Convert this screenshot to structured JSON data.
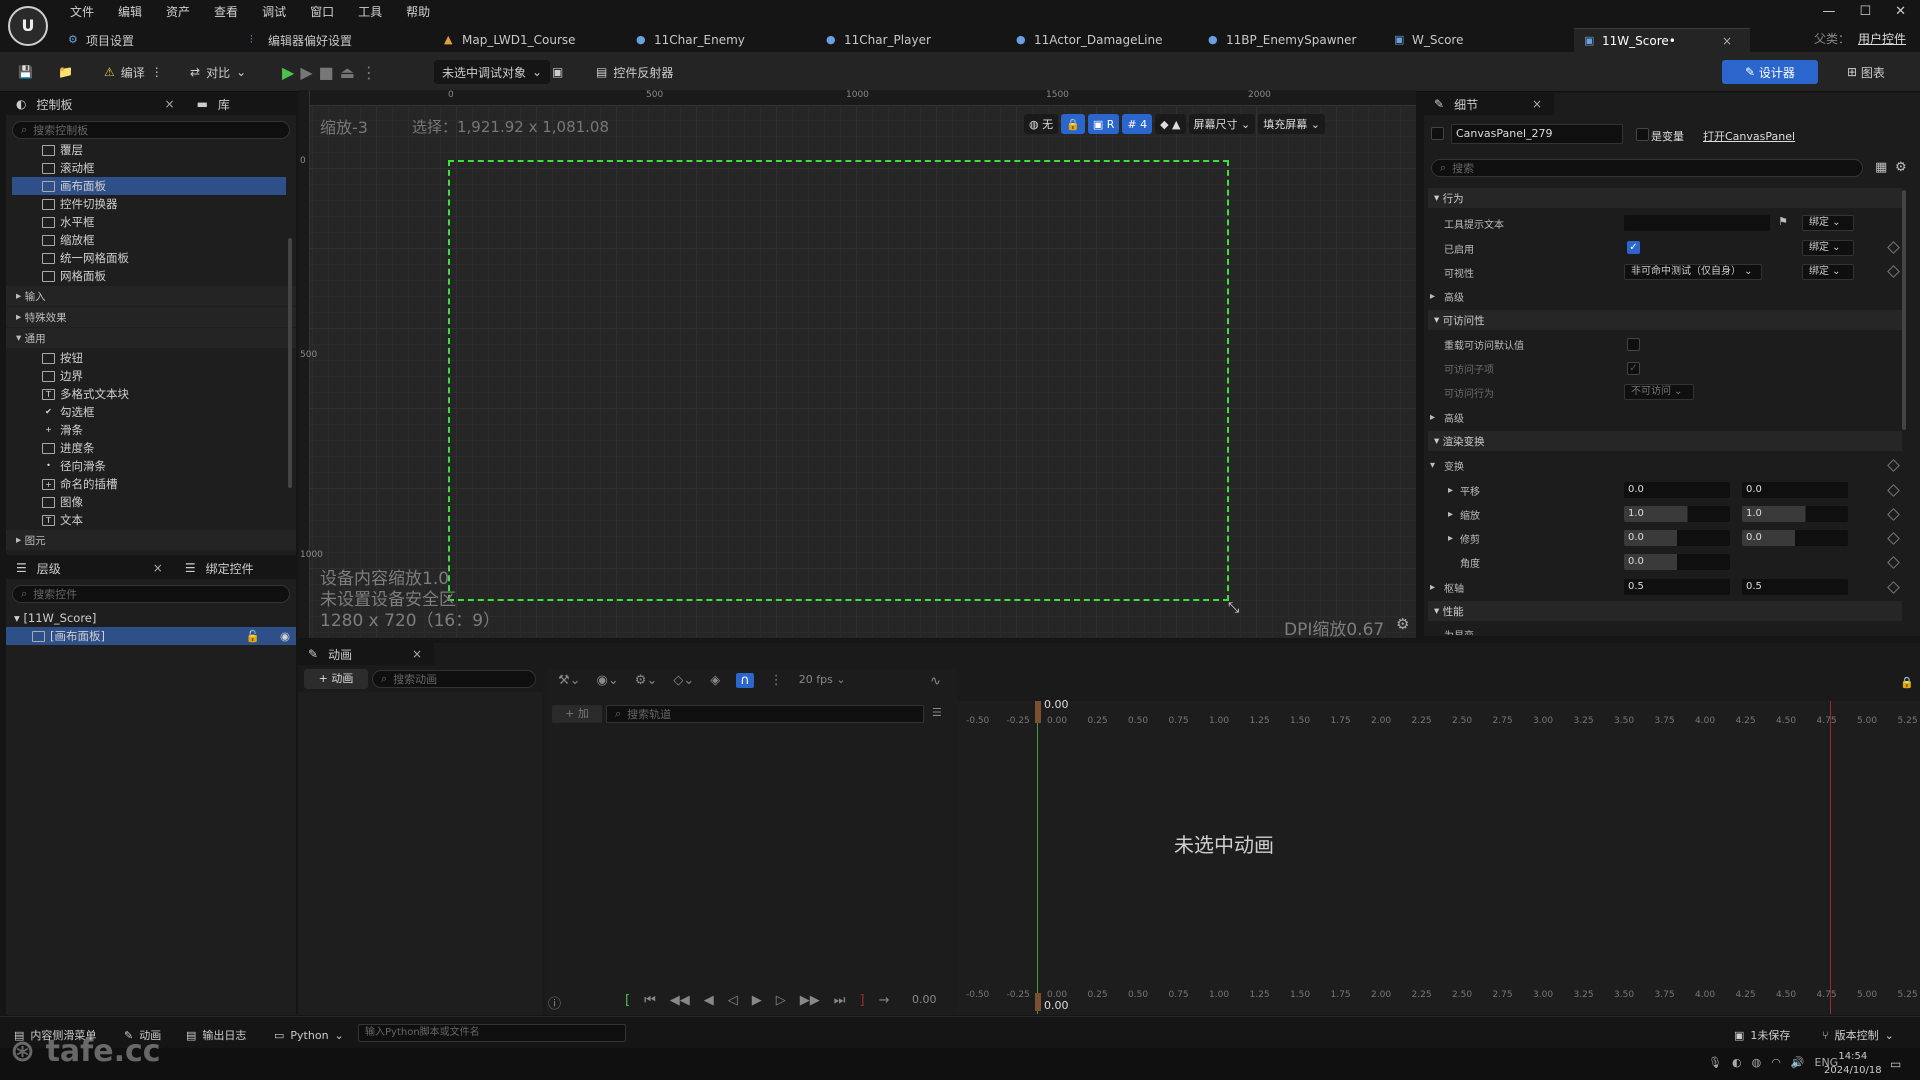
{
  "app": {
    "logo": "U"
  },
  "menu": [
    "文件",
    "编辑",
    "资产",
    "查看",
    "调试",
    "窗口",
    "工具",
    "帮助"
  ],
  "tabs": [
    {
      "label": "项目设置",
      "icon": "gear-icon"
    },
    {
      "label": "编辑器偏好设置",
      "icon": "sliders-icon"
    },
    {
      "label": "Map_LWD1_Course",
      "icon": "level-icon"
    },
    {
      "label": "11Char_Enemy",
      "icon": "character-icon"
    },
    {
      "label": "11Char_Player",
      "icon": "character-icon"
    },
    {
      "label": "11Actor_DamageLine",
      "icon": "actor-icon"
    },
    {
      "label": "11BP_EnemySpawner",
      "icon": "actor-icon"
    },
    {
      "label": "W_Score",
      "icon": "widget-icon"
    },
    {
      "label": "11W_Score•",
      "icon": "widget-icon",
      "active": true
    }
  ],
  "parent": {
    "label": "父类：",
    "value": "用户控件"
  },
  "toolbar": {
    "compile": "编译",
    "diff": "对比",
    "debug_target": "未选中调试对象",
    "reflector": "控件反射器",
    "designer": "设计器",
    "graph": "图表"
  },
  "palette": {
    "tab": "控制板",
    "tab2": "库",
    "search_placeholder": "搜索控制板",
    "items_top": [
      "覆层",
      "滚动框",
      "画布面板",
      "控件切换器",
      "水平框",
      "缩放框",
      "统一网格面板",
      "网格面板"
    ],
    "selected": "画布面板",
    "cat_input": "输入",
    "cat_fx": "特殊效果",
    "cat_common": "通用",
    "items_common": [
      "按钮",
      "边界",
      "多格式文本块",
      "勾选框",
      "滑条",
      "进度条",
      "径向滑条",
      "命名的插槽",
      "图像",
      "文本"
    ],
    "cat_primitive": "图元"
  },
  "hierarchy": {
    "tab": "层级",
    "tab2": "绑定控件",
    "search_placeholder": "搜索控件",
    "root": "[11W_Score]",
    "child": "[画布面板]"
  },
  "viewport": {
    "zoom": "缩放-3",
    "selection": "选择：1,921.92 x 1,081.08",
    "ruler_h": [
      "0",
      "500",
      "1000",
      "1500",
      "2000"
    ],
    "ruler_v": [
      "0",
      "500",
      "1000"
    ],
    "tools": {
      "none": "无",
      "r": "R",
      "grid": "4",
      "screen_size": "屏幕尺寸",
      "fill": "填充屏幕"
    },
    "info1": "设备内容缩放1.0",
    "info2": "未设置设备安全区",
    "info3": "1280 x 720（16：9）",
    "dpi": "DPI缩放0.67"
  },
  "details": {
    "tab": "细节",
    "name": "CanvasPanel_279",
    "is_variable": "是变量",
    "open": "打开CanvasPanel",
    "search_placeholder": "搜索",
    "sec_behavior": "行为",
    "tooltip": "工具提示文本",
    "bind": "绑定",
    "enabled": "已启用",
    "visibility": "可视性",
    "visibility_val": "非可命中测试（仅自身）",
    "advanced": "高级",
    "sec_access": "可访问性",
    "override_access": "重载可访问默认值",
    "access_children": "可访问子项",
    "access_behavior": "可访问行为",
    "access_val": "不可访问",
    "advanced2": "高级",
    "sec_render": "渲染变换",
    "transform": "变换",
    "translation": "平移",
    "t1": "0.0",
    "t2": "0.0",
    "scale": "缩放",
    "s1": "1.0",
    "s2": "1.0",
    "shear": "修剪",
    "sh1": "0.0",
    "sh2": "0.0",
    "angle": "角度",
    "a1": "0.0",
    "pivot": "枢轴",
    "p1": "0.5",
    "p2": "0.5",
    "sec_perf": "性能",
    "volatile": "为易变"
  },
  "anim": {
    "tab": "动画",
    "add": "+ 动画",
    "search_placeholder": "搜索动画",
    "track_add": "+ 加",
    "track_search": "搜索轨道",
    "fps": "20 fps",
    "empty": "未选中动画",
    "time": "0.00",
    "time_end": "0.00",
    "time_top": "0.00",
    "ticks": [
      "-0.50",
      "-0.25",
      "0.00",
      "0.25",
      "0.50",
      "0.75",
      "1.00",
      "1.25",
      "1.50",
      "1.75",
      "2.00",
      "2.25",
      "2.50",
      "2.75",
      "3.00",
      "3.25",
      "3.50",
      "3.75",
      "4.00",
      "4.25",
      "4.50",
      "4.75",
      "5.00",
      "5.25"
    ]
  },
  "status": {
    "content": "内容侧滑菜单",
    "anim": "动画",
    "log": "输出日志",
    "python": "Python",
    "python_placeholder": "输入Python脚本或文件名",
    "unsaved": "1未保存",
    "source": "版本控制"
  },
  "watermark": "tafe.cc",
  "taskbar": {
    "lang": "ENG",
    "time": "14:54",
    "date": "2024/10/18"
  }
}
